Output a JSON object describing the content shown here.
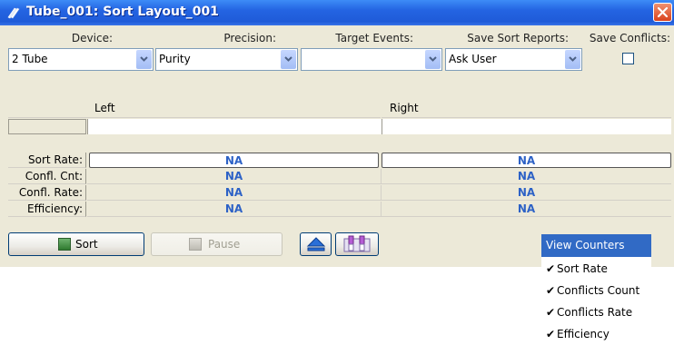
{
  "window": {
    "title": "Tube_001: Sort Layout_001"
  },
  "labels": {
    "device": "Device:",
    "precision": "Precision:",
    "target_events": "Target Events:",
    "save_sort_reports": "Save Sort Reports:",
    "save_conflicts": "Save Conflicts:"
  },
  "combos": {
    "device": "2 Tube",
    "precision": "Purity",
    "target_events": "",
    "save_sort_reports": "Ask User"
  },
  "save_conflicts_checked": false,
  "grid": {
    "left_header": "Left",
    "right_header": "Right",
    "rows": [
      {
        "label": "Sort Rate:",
        "left": "NA",
        "right": "NA"
      },
      {
        "label": "Confl. Cnt:",
        "left": "NA",
        "right": "NA"
      },
      {
        "label": "Confl. Rate:",
        "left": "NA",
        "right": "NA"
      },
      {
        "label": "Efficiency:",
        "left": "NA",
        "right": "NA"
      }
    ]
  },
  "buttons": {
    "sort": "Sort",
    "pause": "Pause"
  },
  "menu": {
    "title": "View Counters",
    "items": [
      "Sort Rate",
      "Conflicts Count",
      "Conflicts Rate",
      "Efficiency"
    ]
  },
  "colors": {
    "title_bar": "#2464e2",
    "cell_value": "#2d62c6",
    "menu_highlight": "#316ac5"
  }
}
